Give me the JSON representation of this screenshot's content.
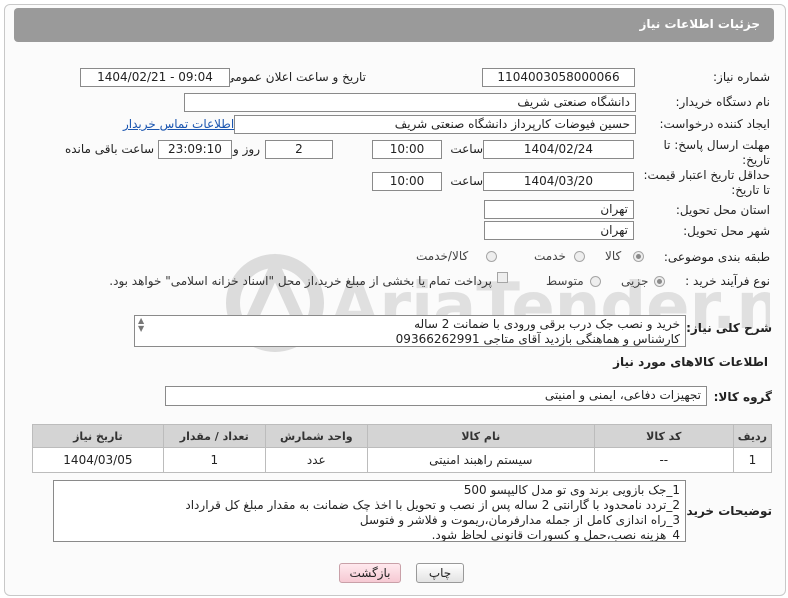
{
  "header": {
    "title": "جزئیات اطلاعات نیاز"
  },
  "fields": {
    "need_number": {
      "label": "شماره نیاز:",
      "value": "1104003058000066"
    },
    "announce": {
      "label": "تاریخ و ساعت اعلان عمومی:",
      "value": "1404/02/21 - 09:04"
    },
    "buyer_org": {
      "label": "نام دستگاه خریدار:",
      "value": "دانشگاه صنعتی شریف"
    },
    "requester": {
      "label": "ایجاد کننده درخواست:",
      "value": "حسین فیوضات کارپرداز دانشگاه صنعتی شریف",
      "contact_link": "اطلاعات تماس خریدار"
    },
    "deadline": {
      "label_line1": "مهلت ارسال پاسخ: تا",
      "label_line2": "تاریخ:",
      "date": "1404/02/24",
      "time_label": "ساعت",
      "time": "10:00",
      "days": "2",
      "days_label": "روز و",
      "remaining": "23:09:10",
      "remaining_label": "ساعت باقی مانده"
    },
    "price_validity": {
      "label_line1": "حداقل تاریخ اعتبار قیمت:",
      "label_line2": "تا تاریخ:",
      "date": "1404/03/20",
      "time_label": "ساعت",
      "time": "10:00"
    },
    "province": {
      "label": "استان محل تحویل:",
      "value": "تهران"
    },
    "city": {
      "label": "شهر محل تحویل:",
      "value": "تهران"
    },
    "category": {
      "label": "طبقه بندی موضوعی:",
      "options": [
        "کالا",
        "خدمت",
        "کالا/خدمت"
      ],
      "selected": "کالا"
    },
    "process": {
      "label": "نوع فرآیند خرید :",
      "options": [
        "جزیی",
        "متوسط"
      ],
      "selected": "جزیی",
      "payment_note": "پرداخت تمام یا بخشی از مبلغ خرید،از محل \"اسناد خزانه اسلامی\" خواهد بود."
    }
  },
  "description": {
    "label": "شرح کلی نیاز:",
    "lines": [
      "خرید و نصب جک درب برقی ورودی با ضمانت 2 ساله",
      "کارشناس و هماهنگی بازدید آقای متاجی 09366262991"
    ]
  },
  "goods_section": {
    "title": "اطلاعات کالاهای مورد نیاز"
  },
  "goods_group": {
    "label": "گروه کالا:",
    "value": "تجهیزات دفاعی، ایمنی و امنیتی"
  },
  "table": {
    "headers": [
      "ردیف",
      "کد کالا",
      "نام کالا",
      "واحد شمارش",
      "تعداد / مقدار",
      "تاریخ نیاز"
    ],
    "rows": [
      [
        "1",
        "--",
        "سیستم راهبند امنیتی",
        "عدد",
        "1",
        "1404/03/05"
      ]
    ]
  },
  "buyer_notes": {
    "label": "توضیحات خریدار:",
    "lines": [
      "1_جک بازویی برند وی تو مدل کالیپسو 500",
      "2_تردد نامحدود با گارانتی 2 ساله پس از نصب و تحویل با اخذ چک ضمانت به مقدار مبلغ کل قرارداد",
      "3_راه اندازی کامل از جمله مدارفرمان،ریموت و فلاشر و فتوسل",
      "4_هزینه نصب،حمل و کسورات قانونی لحاظ شود."
    ]
  },
  "buttons": {
    "print": "چاپ",
    "back": "بازگشت"
  },
  "watermark": {
    "text": "AriaTender.net"
  },
  "colors": {
    "header_bg": "#9a9a9a",
    "link": "#1a55b0",
    "table_header": "#d4d4d4",
    "back_button": "#f6c9d3",
    "watermark": "#d9d9d9"
  }
}
